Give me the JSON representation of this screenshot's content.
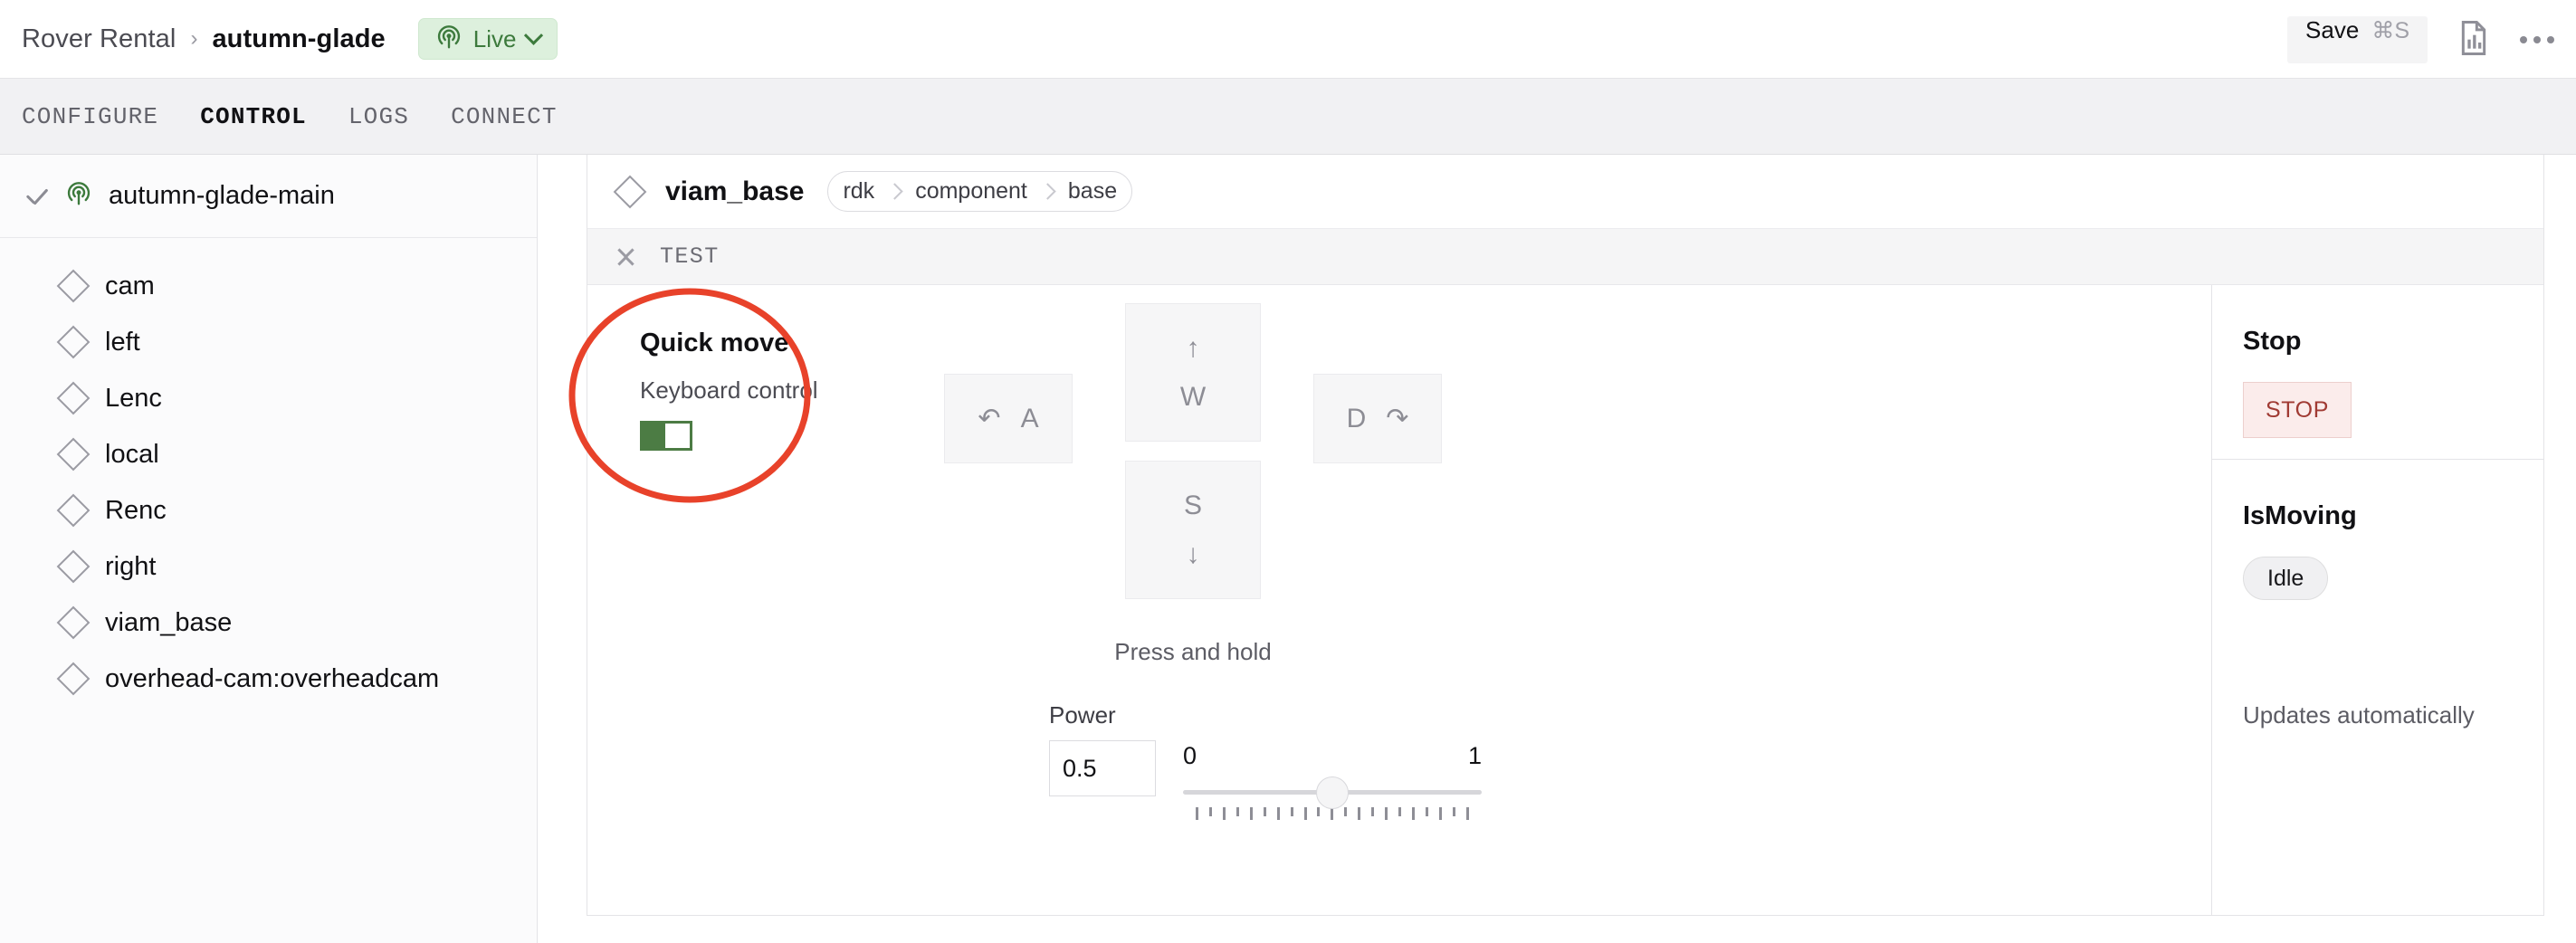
{
  "topbar": {
    "org": "Rover Rental",
    "separator": "›",
    "machine": "autumn-glade",
    "live_label": "Live",
    "save_label": "Save",
    "save_shortcut": "⌘S"
  },
  "tabs": [
    {
      "label": "CONFIGURE",
      "active": false
    },
    {
      "label": "CONTROL",
      "active": true
    },
    {
      "label": "LOGS",
      "active": false
    },
    {
      "label": "CONNECT",
      "active": false
    }
  ],
  "sidebar": {
    "main": {
      "label": "autumn-glade-main"
    },
    "items": [
      {
        "label": "cam"
      },
      {
        "label": "left"
      },
      {
        "label": "Lenc"
      },
      {
        "label": "local"
      },
      {
        "label": "Renc"
      },
      {
        "label": "right"
      },
      {
        "label": "viam_base"
      },
      {
        "label": "overhead-cam:overheadcam"
      }
    ]
  },
  "card": {
    "name": "viam_base",
    "chips": [
      "rdk",
      "component",
      "base"
    ],
    "section_label": "TEST"
  },
  "quick_move": {
    "title": "Quick move",
    "subtitle": "Keyboard control",
    "toggle_on": true
  },
  "keypad": {
    "w": {
      "arrow": "↑",
      "letter": "W"
    },
    "s": {
      "letter": "S",
      "arrow": "↓"
    },
    "a": {
      "arrow": "↶",
      "letter": "A"
    },
    "d": {
      "letter": "D",
      "arrow": "↷"
    },
    "hint": "Press and hold"
  },
  "power": {
    "label": "Power",
    "value": "0.5",
    "min_label": "0",
    "max_label": "1",
    "slider_percent": 50
  },
  "status": {
    "stop_title": "Stop",
    "stop_button": "STOP",
    "moving_title": "IsMoving",
    "moving_value": "Idle",
    "updates_note": "Updates automatically"
  },
  "colors": {
    "live_green": "#3c7a3c",
    "toggle_green": "#4c7c44",
    "stop_red": "#a03a33",
    "annotation_red": "#e8422a"
  }
}
